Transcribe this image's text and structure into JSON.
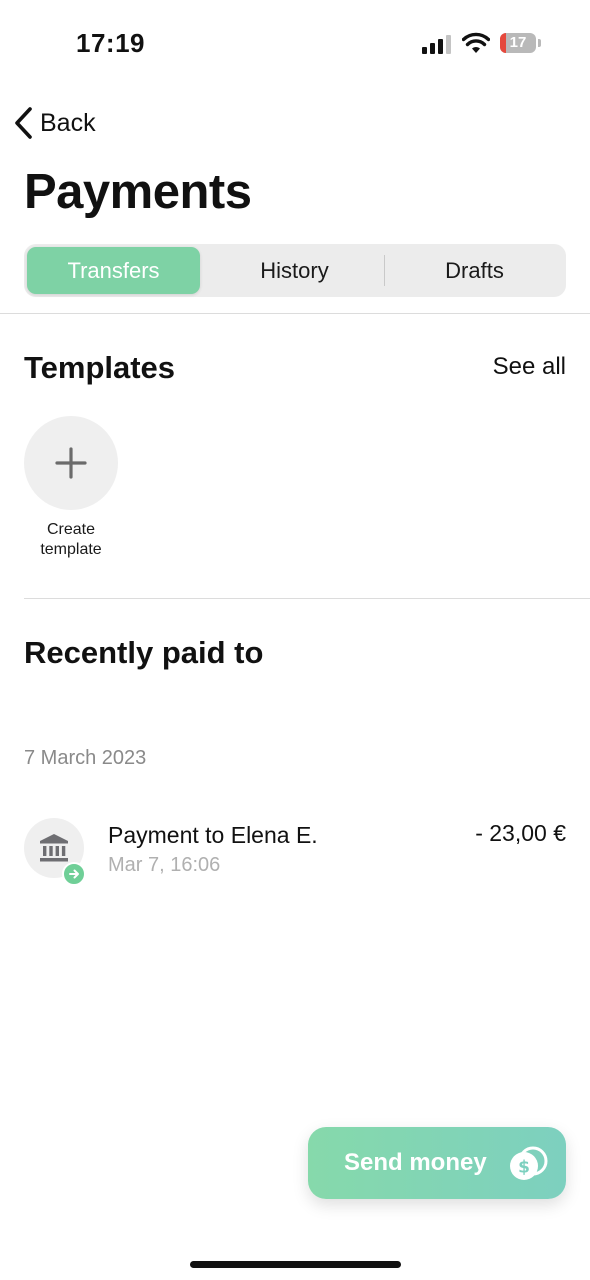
{
  "status_bar": {
    "time": "17:19",
    "battery_level": "17",
    "icons": [
      "cellular-signal-icon",
      "wifi-icon",
      "battery-icon"
    ]
  },
  "nav": {
    "back_label": "Back"
  },
  "page_title": "Payments",
  "tabs": [
    {
      "label": "Transfers",
      "active": true
    },
    {
      "label": "History",
      "active": false
    },
    {
      "label": "Drafts",
      "active": false
    }
  ],
  "templates": {
    "title": "Templates",
    "see_all": "See all",
    "create_label_line1": "Create",
    "create_label_line2": "template"
  },
  "recent": {
    "title": "Recently paid to",
    "groups": [
      {
        "date": "7 March 2023",
        "items": [
          {
            "payee": "Payment to Elena E.",
            "time": "Mar 7, 16:06",
            "amount": "- 23,00 €",
            "icon": "bank-icon"
          }
        ]
      }
    ]
  },
  "send_money": {
    "label": "Send money",
    "icon": "coins-icon"
  },
  "colors": {
    "accent": "#7ed2a5",
    "badge": "#6fcf97",
    "battery_low": "#e5483c"
  }
}
